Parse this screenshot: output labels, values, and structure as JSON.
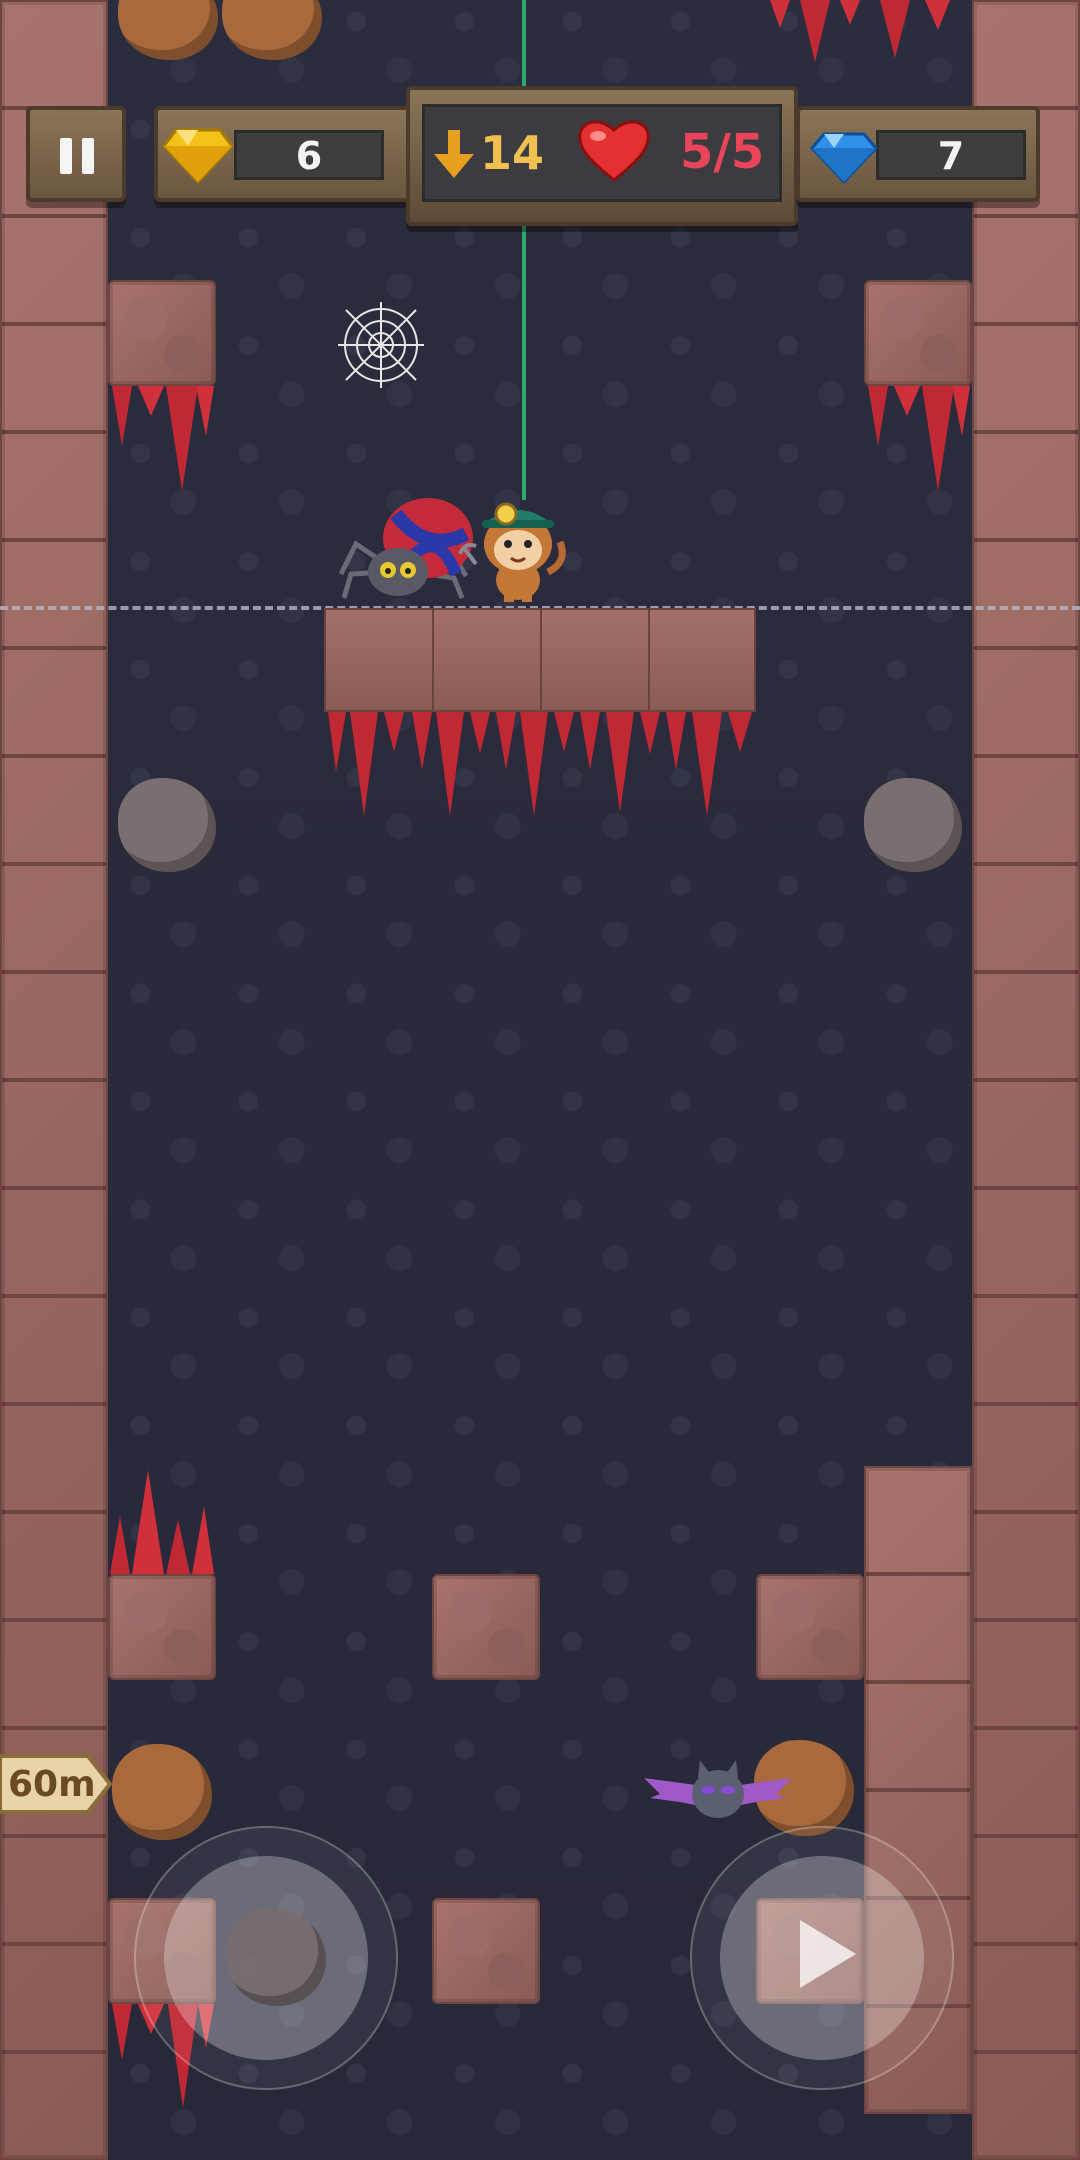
{
  "hud": {
    "pause_label": "II",
    "gold_gems": "6",
    "depth": "14",
    "lives": "5/5",
    "blue_gems": "7"
  },
  "depth_marker": "60m",
  "colors": {
    "rock": "#9c6a64",
    "spike": "#d0303a",
    "hud_wood": "#7a6549",
    "lives_text": "#e8455a",
    "depth_text": "#f0c050"
  },
  "icons": {
    "gold_gem": "gold-gem-icon",
    "blue_gem": "blue-gem-icon",
    "depth": "down-arrow-icon",
    "lives": "heart-icon",
    "play": "play-icon"
  }
}
